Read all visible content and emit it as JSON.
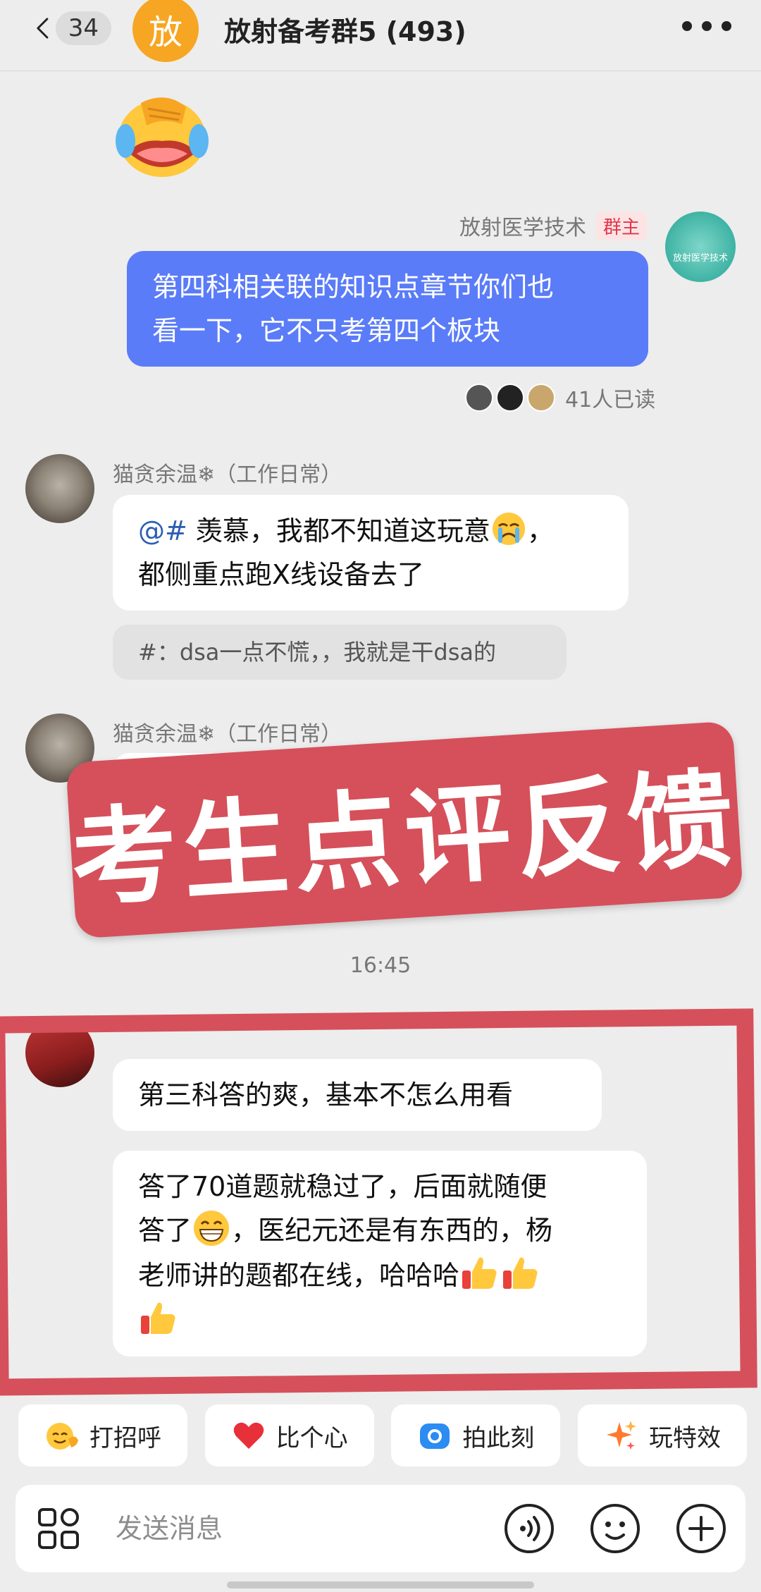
{
  "header": {
    "back_count": "34",
    "group_avatar_text": "放",
    "title": "放射备考群5 (493)"
  },
  "messages": {
    "owner": {
      "name": "放射医学技术",
      "badge": "群主",
      "avatar_text": "放射医学技术",
      "line1": "第四科相关联的知识点章节你们也",
      "line2": "看一下，它不只考第四个板块",
      "read_status": "41人已读"
    },
    "cat1": {
      "name": "猫贪余温❄（工作日常）",
      "mention": "@#",
      "line1_text": " 羡慕，我都不知道这玩意",
      "line1_tail": "，",
      "line2": "都侧重点跑X线设备去了",
      "quote": "#：dsa一点不慌，，我就是干dsa的"
    },
    "cat2": {
      "name": "猫贪余温❄（工作日常）"
    },
    "time": "16:45",
    "user3": {
      "msg1": "第三科答的爽，基本不怎么用看",
      "line1": "答了70道题就稳过了，后面就随便",
      "line2_a": "答了",
      "line2_b": "，医纪元还是有东西的，杨",
      "line3": "老师讲的题都在线，哈哈哈"
    }
  },
  "banner": {
    "text": "考生点评反馈"
  },
  "quick_actions": [
    {
      "label": "打招呼",
      "icon": "wave-emoji-icon"
    },
    {
      "label": "比个心",
      "icon": "heart-icon"
    },
    {
      "label": "拍此刻",
      "icon": "camera-icon"
    },
    {
      "label": "玩特效",
      "icon": "sparkle-icon"
    }
  ],
  "input": {
    "placeholder": "发送消息"
  },
  "colors": {
    "accent_blue": "#5b7cf8",
    "banner_red": "#d5505a",
    "group_avatar": "#f6a623",
    "background": "#ededed"
  }
}
